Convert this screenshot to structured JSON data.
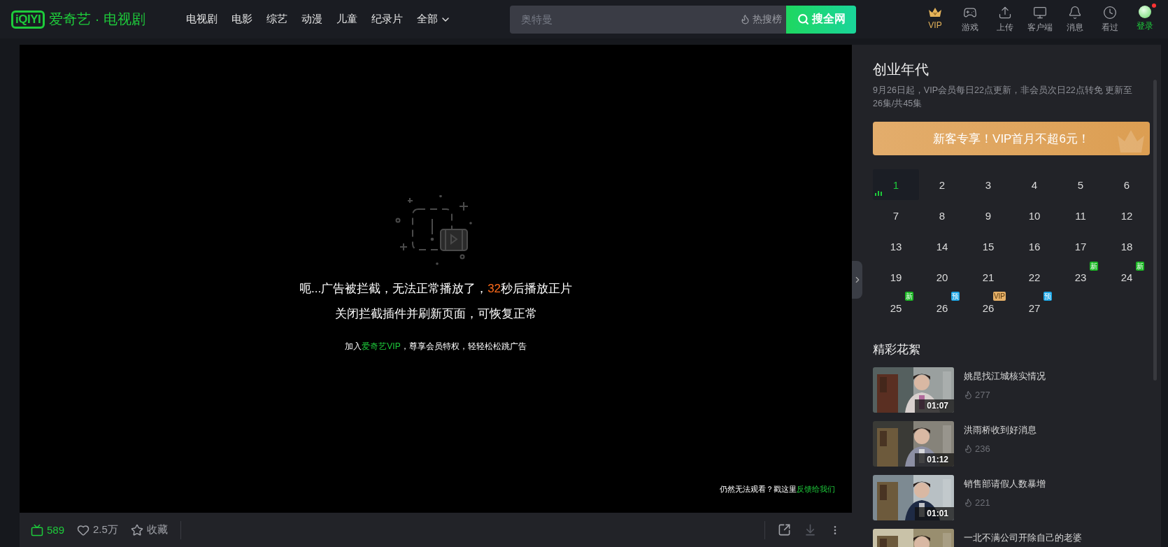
{
  "header": {
    "logo_mark": "iQIYI",
    "logo_text": "爱奇艺 · 电视剧",
    "nav": [
      "电视剧",
      "电影",
      "综艺",
      "动漫",
      "儿童",
      "纪录片"
    ],
    "nav_more": "全部",
    "search": {
      "placeholder": "奥特曼",
      "hot": "热搜榜",
      "button": "搜全网"
    },
    "actions": [
      {
        "kind": "vip",
        "label": "VIP"
      },
      {
        "kind": "game",
        "label": "游戏"
      },
      {
        "kind": "upload",
        "label": "上传"
      },
      {
        "kind": "client",
        "label": "客户端"
      },
      {
        "kind": "message",
        "label": "消息"
      },
      {
        "kind": "history",
        "label": "看过"
      },
      {
        "kind": "login",
        "label": "登录",
        "notify": true
      }
    ]
  },
  "player": {
    "notice_before": "呃...广告被拦截，无法正常播放了，",
    "countdown": "32",
    "notice_after": "秒后播放正片",
    "notice_line2": "关闭拦截插件并刷新页面，可恢复正常",
    "join_before": "加入",
    "join_link": "爱奇艺VIP",
    "join_after": "，尊享会员特权，轻轻松松跳广告",
    "feedback_before": "仍然无法观看？戳这里",
    "feedback_link": "反馈给我们"
  },
  "bottom_bar": {
    "stats": [
      {
        "kind": "danmaku",
        "label": "589",
        "on": true
      },
      {
        "kind": "like",
        "label": "2.5万",
        "on": false
      },
      {
        "kind": "collect",
        "label": "收藏",
        "on": false
      }
    ],
    "tools": [
      {
        "kind": "share",
        "disabled": false
      },
      {
        "kind": "download",
        "disabled": true
      },
      {
        "kind": "more",
        "disabled": false
      }
    ]
  },
  "sidebar": {
    "title": "创业年代",
    "description": "9月26日起，VIP会员每日22点更新，非会员次日22点转免 更新至26集/共45集",
    "promo": "新客专享！VIP首月不超6元！",
    "episodes": [
      {
        "label": "1",
        "selected": true
      },
      {
        "label": "2",
        "selected": false
      },
      {
        "label": "3",
        "selected": false
      },
      {
        "label": "4",
        "selected": false
      },
      {
        "label": "5",
        "selected": false
      },
      {
        "label": "6",
        "selected": false
      },
      {
        "label": "7",
        "selected": false
      },
      {
        "label": "8",
        "selected": false
      },
      {
        "label": "9",
        "selected": false
      },
      {
        "label": "10",
        "selected": false
      },
      {
        "label": "11",
        "selected": false
      },
      {
        "label": "12",
        "selected": false
      },
      {
        "label": "13",
        "selected": false
      },
      {
        "label": "14",
        "selected": false
      },
      {
        "label": "15",
        "selected": false
      },
      {
        "label": "16",
        "selected": false
      },
      {
        "label": "17",
        "selected": false
      },
      {
        "label": "18",
        "selected": false
      },
      {
        "label": "19",
        "selected": false
      },
      {
        "label": "20",
        "selected": false
      },
      {
        "label": "21",
        "selected": false
      },
      {
        "label": "22",
        "selected": false
      },
      {
        "label": "23",
        "selected": false,
        "badge": {
          "kind": "new",
          "text": "新"
        }
      },
      {
        "label": "24",
        "selected": false,
        "badge": {
          "kind": "new",
          "text": "新"
        }
      },
      {
        "label": "25",
        "selected": false,
        "badge": {
          "kind": "new",
          "text": "新"
        }
      },
      {
        "label": "26",
        "selected": false,
        "badge": {
          "kind": "preview",
          "text": "预"
        }
      },
      {
        "label": "26",
        "selected": false,
        "badge": {
          "kind": "vip",
          "text": "VIP"
        }
      },
      {
        "label": "27",
        "selected": false,
        "badge": {
          "kind": "preview",
          "text": "预"
        }
      }
    ],
    "clips_title": "精彩花絮",
    "clips": [
      {
        "title": "姚昆找江城核实情况",
        "views": "277",
        "duration": "01:07"
      },
      {
        "title": "洪雨桥收到好消息",
        "views": "236",
        "duration": "01:12"
      },
      {
        "title": "销售部请假人数暴增",
        "views": "221",
        "duration": "01:01"
      },
      {
        "title": "一北不满公司开除自己的老婆"
      }
    ]
  }
}
